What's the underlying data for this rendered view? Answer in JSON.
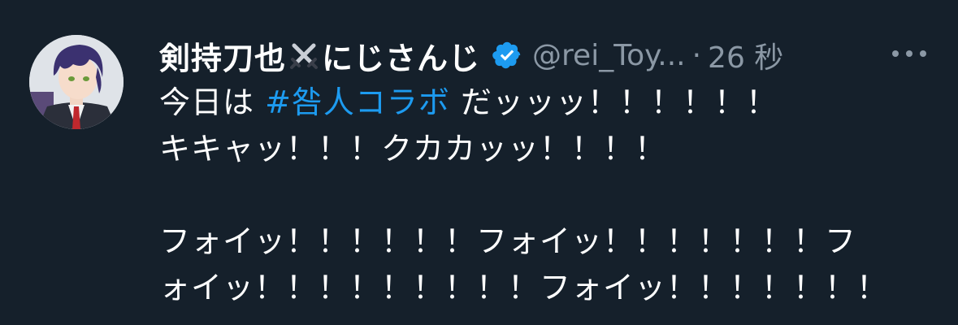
{
  "tweet": {
    "display_name_part1": "剣持刀也",
    "display_name_part2": "にじさんじ",
    "handle": "@rei_Toy...",
    "separator": "·",
    "time": "26 秒",
    "body": {
      "line1_prefix": "今日は ",
      "hashtag": "#咎人コラボ",
      "line1_suffix": " だッッッ！！！！！！",
      "line2": "キキャッ！！！クカカッッ！！！！",
      "line3": "",
      "line4": "フォイッ！！！！！！フォイッ！！！！！！！フ",
      "line5": "ォイッ！！！！！！！！！フォイッ！！！！！！！"
    }
  },
  "icons": {
    "avatar": "avatar",
    "swords": "crossed-swords-icon",
    "verified": "verified-badge-icon",
    "more": "more-options-icon"
  },
  "colors": {
    "background": "#15202b",
    "text": "#ffffff",
    "secondary_text": "#8b98a5",
    "link": "#1d9bf0",
    "verified": "#1d9bf0"
  }
}
